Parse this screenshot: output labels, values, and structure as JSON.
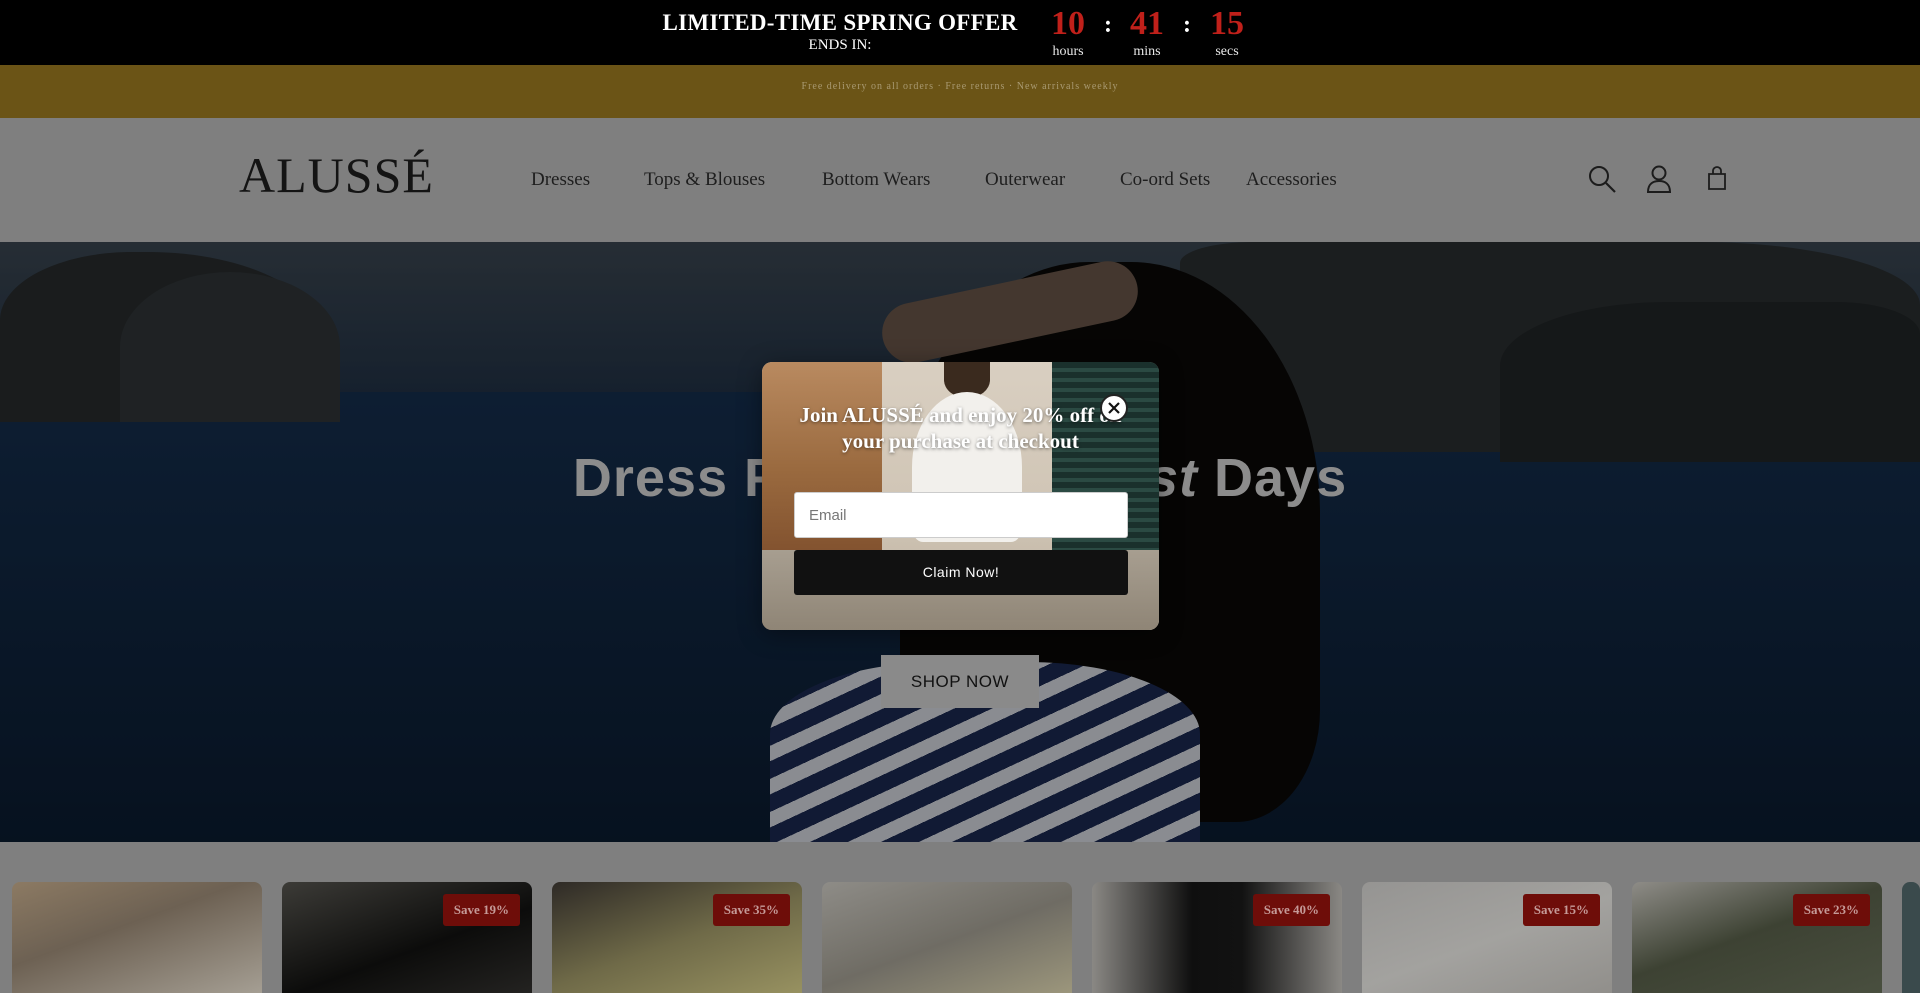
{
  "countdown": {
    "title": "LIMITED-TIME SPRING OFFER",
    "subtitle": "ENDS IN:",
    "hours": "10",
    "hours_label": "hours",
    "mins": "41",
    "mins_label": "mins",
    "secs": "15",
    "secs_label": "secs",
    "separator": ":"
  },
  "announcement": {
    "text": "Free delivery on all orders · Free returns · New arrivals weekly"
  },
  "header": {
    "logo": "ALUSSÉ",
    "nav": [
      "Dresses",
      "Tops & Blouses",
      "Bottom Wears",
      "Outerwear",
      "Co-ord Sets",
      "Accessories"
    ],
    "icons": [
      "search-icon",
      "account-icon",
      "cart-icon"
    ]
  },
  "hero": {
    "title_part1": "Dress F",
    "title_italic": "st",
    "title_part2": "Days",
    "button": "SHOP NOW"
  },
  "popup": {
    "title": "Join ALUSSÉ and enjoy 20% off on your purchase at checkout",
    "email_placeholder": "Email",
    "claim_button": "Claim Now!"
  },
  "products": {
    "badges": [
      "",
      "Save 19%",
      "Save 35%",
      "",
      "Save 40%",
      "Save 15%",
      "Save 23%"
    ]
  },
  "colors": {
    "countdown_digits": "#c0201a",
    "announcement_bg": "#6b5416",
    "badge_bg": "#6e0d09"
  }
}
